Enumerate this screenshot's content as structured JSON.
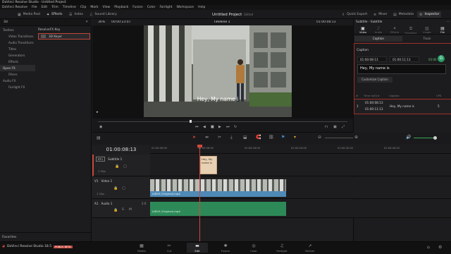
{
  "window_title": "DaVinci Resolve Studio - Untitled Project",
  "menu": [
    "DaVinci Resolve",
    "File",
    "Edit",
    "Trim",
    "Timeline",
    "Clip",
    "Mark",
    "View",
    "Playback",
    "Fusion",
    "Color",
    "Fairlight",
    "Workspace",
    "Help"
  ],
  "toolbar": {
    "media_pool": "Media Pool",
    "effects": "Effects",
    "index": "Index",
    "sound_library": "Sound Library",
    "project_title": "Untitled Project",
    "edited": "Edited",
    "quick_export": "Quick Export",
    "mixer": "Mixer",
    "metadata": "Metadata",
    "inspector": "Inspector"
  },
  "left_panel": {
    "search_value": "3d",
    "tree": [
      {
        "label": "Toolbox",
        "level": 0
      },
      {
        "label": "Video Transitions",
        "level": 1
      },
      {
        "label": "Audio Transitions",
        "level": 1
      },
      {
        "label": "Titles",
        "level": 1
      },
      {
        "label": "Generators",
        "level": 1
      },
      {
        "label": "Effects",
        "level": 1
      },
      {
        "label": "Open FX",
        "level": 0,
        "selected": true
      },
      {
        "label": "Filters",
        "level": 1
      },
      {
        "label": "Audio FX",
        "level": 0
      },
      {
        "label": "Fairlight FX",
        "level": 1
      }
    ],
    "fx_header": "ResolveFX Key",
    "fx_item": "3D Keyer",
    "favorites": "Favorites"
  },
  "viewer": {
    "zoom": "36%",
    "source_timecode": "00:00:23:07",
    "timeline_name": "Timeline 1",
    "record_timecode": "01:00:08:13",
    "overlay_subtitle": "Hey, My name i"
  },
  "inspector": {
    "title": "Subtitle - Subtitle",
    "tabs": [
      "Video",
      "Audio",
      "Effects",
      "Transition",
      "Image",
      "File"
    ],
    "subtabs": [
      "Caption",
      "Track"
    ],
    "caption_label": "Caption",
    "in_time": "01:00:08:13",
    "out_time": "01:00:11:13",
    "duration": "03:00",
    "caption_text": "Hey, My name is",
    "custom_caption": "Customize Caption",
    "add_new": "Add New",
    "prev": "Prev",
    "next": "Next",
    "table_headers": [
      "#",
      "Time In/Out",
      "Caption",
      "CPS"
    ],
    "table_row": {
      "index": "1",
      "time_in": "01:00:08:13",
      "time_out": "01:00:11:13",
      "caption": "Hey, My name is",
      "cps": "5"
    }
  },
  "timeline": {
    "current_timecode": "01:00:08:13",
    "ruler": [
      "01:00:00:00",
      "01:00:08:00",
      "01:00:16:00",
      "01:00:24:00",
      "01:00:32:00",
      "01:00:40:00"
    ],
    "tracks": [
      {
        "id": "ST1",
        "name": "Subtitle 1",
        "clips": "1 Clip"
      },
      {
        "id": "V1",
        "name": "Video 1",
        "clips": "1 Clip"
      },
      {
        "id": "A1",
        "name": "Audio 1",
        "clips": "",
        "channel": "2.0"
      }
    ],
    "subtitle_clip_text": "Hey, My name is",
    "video_clip_name": "14829 (Original).mp4",
    "audio_clip_name": "14829 (Original).mp4"
  },
  "pagebar": {
    "brand": "DaVinci Resolve Studio 18.5",
    "beta": "PUBLIC BETA",
    "pages": [
      "Media",
      "Cut",
      "Edit",
      "Fusion",
      "Color",
      "Fairlight",
      "Deliver"
    ],
    "active_page": "Edit"
  },
  "colors": {
    "accent": "#c0473c",
    "video_clip": "#4f8ab7",
    "audio_clip": "#2d8a58",
    "subtitle_clip": "#e8d0b3"
  }
}
